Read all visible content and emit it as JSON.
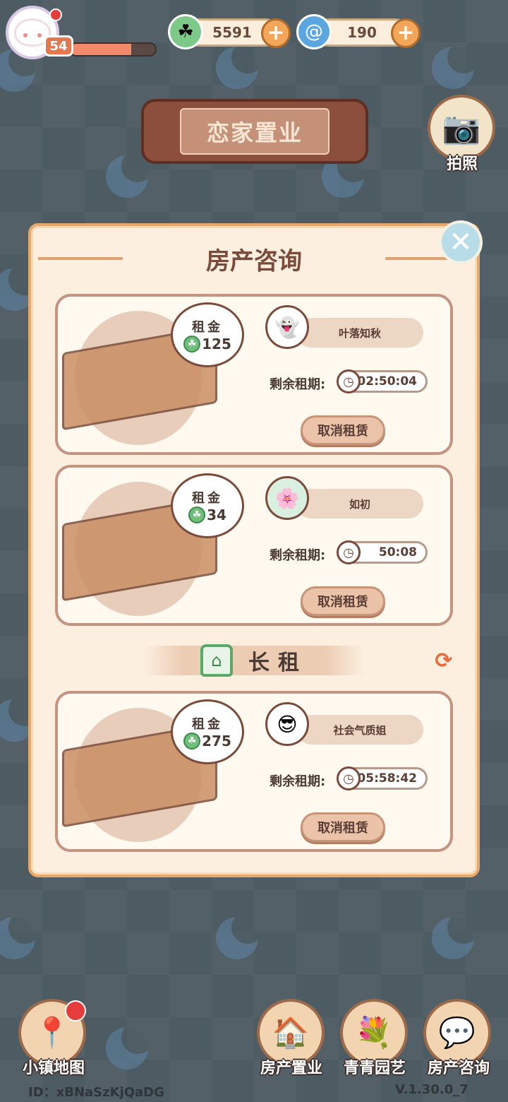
{
  "hud": {
    "level": "54",
    "xp_progress": 0.72,
    "clover_currency": "5591",
    "swirl_currency": "190",
    "plus_symbol": "+"
  },
  "header": {
    "title": "恋家置业",
    "camera_label": "拍照"
  },
  "modal": {
    "title": "房产咨询",
    "close_symbol": "✕",
    "rent_label": "租金",
    "lease_label": "剩余租期:",
    "cancel_label": "取消租赁",
    "section_label": "长租",
    "refresh_symbol": "⟳"
  },
  "rentals": [
    {
      "rent": "125",
      "tenant": "叶落知秋",
      "remaining": "02:50:04",
      "avatar_icon": "ghost-icon"
    },
    {
      "rent": "34",
      "tenant": "如初",
      "remaining": "50:08",
      "avatar_icon": "lotus-icon"
    },
    {
      "rent": "275",
      "tenant": "社会气质姐",
      "remaining": "05:58:42",
      "avatar_icon": "sunglasses-icon"
    }
  ],
  "nav": {
    "map": "小镇地图",
    "property": "房产置业",
    "garden": "青青园艺",
    "consult": "房产咨询"
  },
  "footer": {
    "id": "ID：xBNaSzKjQaDG",
    "version": "V.1.30.0_7"
  },
  "colors": {
    "background": "#4d5b63",
    "modal": "#fcefdf",
    "accent": "#e8a86a",
    "clover": "#6fbf7a"
  }
}
